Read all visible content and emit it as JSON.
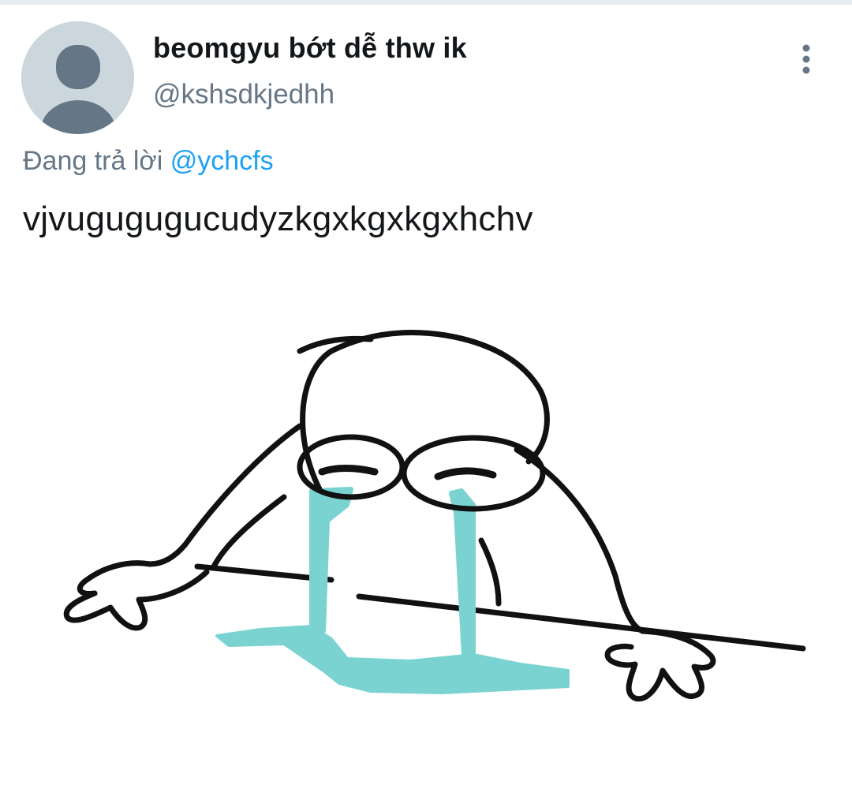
{
  "tweet": {
    "author": {
      "display_name": "beomgyu bớt dễ thw ik",
      "handle": "@kshsdkjedhh",
      "avatar_icon": "default-profile-avatar-icon"
    },
    "reply": {
      "prefix": "Đang trả lời",
      "mention": "@ychcfs"
    },
    "text": "vjvugugugucudyzkgxkgxkgxhchv",
    "menu_icon": "vertical-ellipsis-icon",
    "media": {
      "description_icon": "crying-stick-figure-drawing"
    }
  },
  "colors": {
    "accent": "#1da1f2",
    "secondary_text": "#657786",
    "primary_text": "#14171a",
    "avatar_bg": "#ccd6dd",
    "avatar_fg": "#657786",
    "tears": "#7ad3d1"
  }
}
